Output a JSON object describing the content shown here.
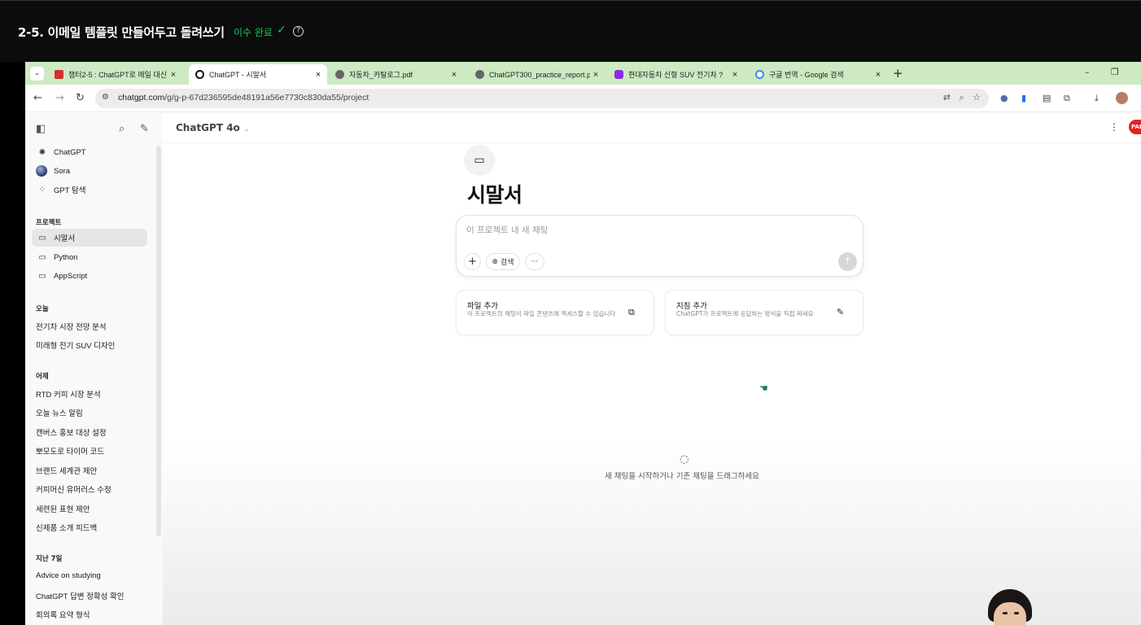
{
  "course": {
    "title": "2-5. 이메일 템플릿 만들어두고 돌려쓰기",
    "status": "이수 완료",
    "check_glyph": "✓",
    "help_glyph": "?"
  },
  "browser": {
    "tabs": [
      {
        "label": "챕터2-5 : ChatGPT로 메일 대신",
        "favicon_color": "#d0312d",
        "active": false
      },
      {
        "label": "ChatGPT - 시말서",
        "favicon_color": "#111111",
        "active": true
      },
      {
        "label": "자동차_카탈로그.pdf",
        "favicon_color": "#444444",
        "active": false
      },
      {
        "label": "ChatGPT300_practice_report.p",
        "favicon_color": "#444444",
        "active": false
      },
      {
        "label": "현대자동차 신형 SUV 전기차 ?",
        "favicon_color": "#8a2be2",
        "active": false
      },
      {
        "label": "구글 번역 - Google 검색",
        "favicon_color": "#4285f4",
        "active": false
      }
    ],
    "tab_close_glyph": "×",
    "new_tab_glyph": "+",
    "minimize_glyph": "–",
    "restore_glyph": "❐",
    "url_host": "chatgpt.com",
    "url_path": "/g/g-p-67d236595de48191a56e7730c830da55/project"
  },
  "sidebar": {
    "top_items": [
      {
        "label": "ChatGPT",
        "icon": "openai-icon"
      },
      {
        "label": "Sora",
        "icon": "sora-icon"
      },
      {
        "label": "GPT 탐색",
        "icon": "grid-icon"
      }
    ],
    "projects_heading": "프로젝트",
    "projects": [
      "시말서",
      "Python",
      "AppScript"
    ],
    "today_heading": "오늘",
    "today": [
      "전기차 시장 전망 분석",
      "미래형 전기 SUV 디자인"
    ],
    "yesterday_heading": "어제",
    "yesterday": [
      "RTD 커피 시장 분석",
      "오늘 뉴스 알림",
      "캔버스 홍보 대상 설정",
      "뽀모도로 타이머 코드",
      "브랜드 세계관 제안",
      "커피머신 유머러스 수정",
      "세련된 표현 제안",
      "신제품 소개 피드백"
    ],
    "week_heading": "지난 7일",
    "week": [
      "Advice on studying",
      "ChatGPT 답변 정확성 확인",
      "회의록 요약 형식"
    ]
  },
  "main": {
    "model_name": "ChatGPT 4o",
    "project_title": "시말서",
    "composer_placeholder": "이 프로젝트 내 새 채팅",
    "search_label": "검색",
    "more_glyph": "···",
    "plus_glyph": "+",
    "send_glyph": "↑",
    "header_badge": "PAR",
    "cards": [
      {
        "title": "파일 추가",
        "desc": "이 프로젝트의 채팅이 파일 콘텐츠에 액세스할 수 있습니다",
        "icon": "add-file-icon"
      },
      {
        "title": "지침 추가",
        "desc": "ChatGPT가 프로젝트에 응답하는 방식을 직접 짜세요",
        "icon": "pencil-icon"
      }
    ],
    "empty_text": "새 채팅을 시작하거나 기존 채팅을 드래그하세요"
  }
}
